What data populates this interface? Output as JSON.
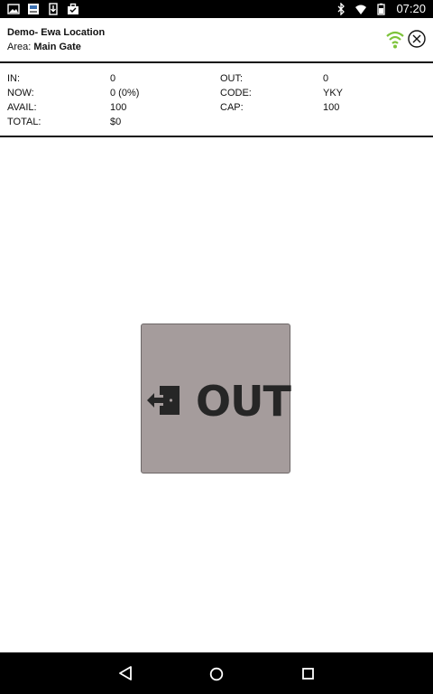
{
  "status_bar": {
    "time": "07:20",
    "left_icons": [
      "image-icon",
      "app-icon",
      "download-icon",
      "briefcase-icon"
    ],
    "right_icons": [
      "bluetooth-icon",
      "wifi-status-icon",
      "battery-icon"
    ]
  },
  "header": {
    "location_name": "Demo- Ewa Location",
    "area_label": "Area:",
    "area_value": "Main Gate",
    "wifi_color": "#7dc33a"
  },
  "stats": {
    "in_label": "IN:",
    "in_value": "0",
    "out_label": "OUT:",
    "out_value": "0",
    "now_label": "NOW:",
    "now_value": "0 (0%)",
    "code_label": "CODE:",
    "code_value": "YKY",
    "avail_label": "AVAIL:",
    "avail_value": "100",
    "cap_label": "CAP:",
    "cap_value": "100",
    "total_label": "TOTAL:",
    "total_value": "$0"
  },
  "out_button": {
    "label": "OUT",
    "icon": "exit-door-icon",
    "background": "#a59c9c"
  },
  "nav_bar": {
    "buttons": [
      "back-icon",
      "home-icon",
      "recents-icon"
    ]
  }
}
